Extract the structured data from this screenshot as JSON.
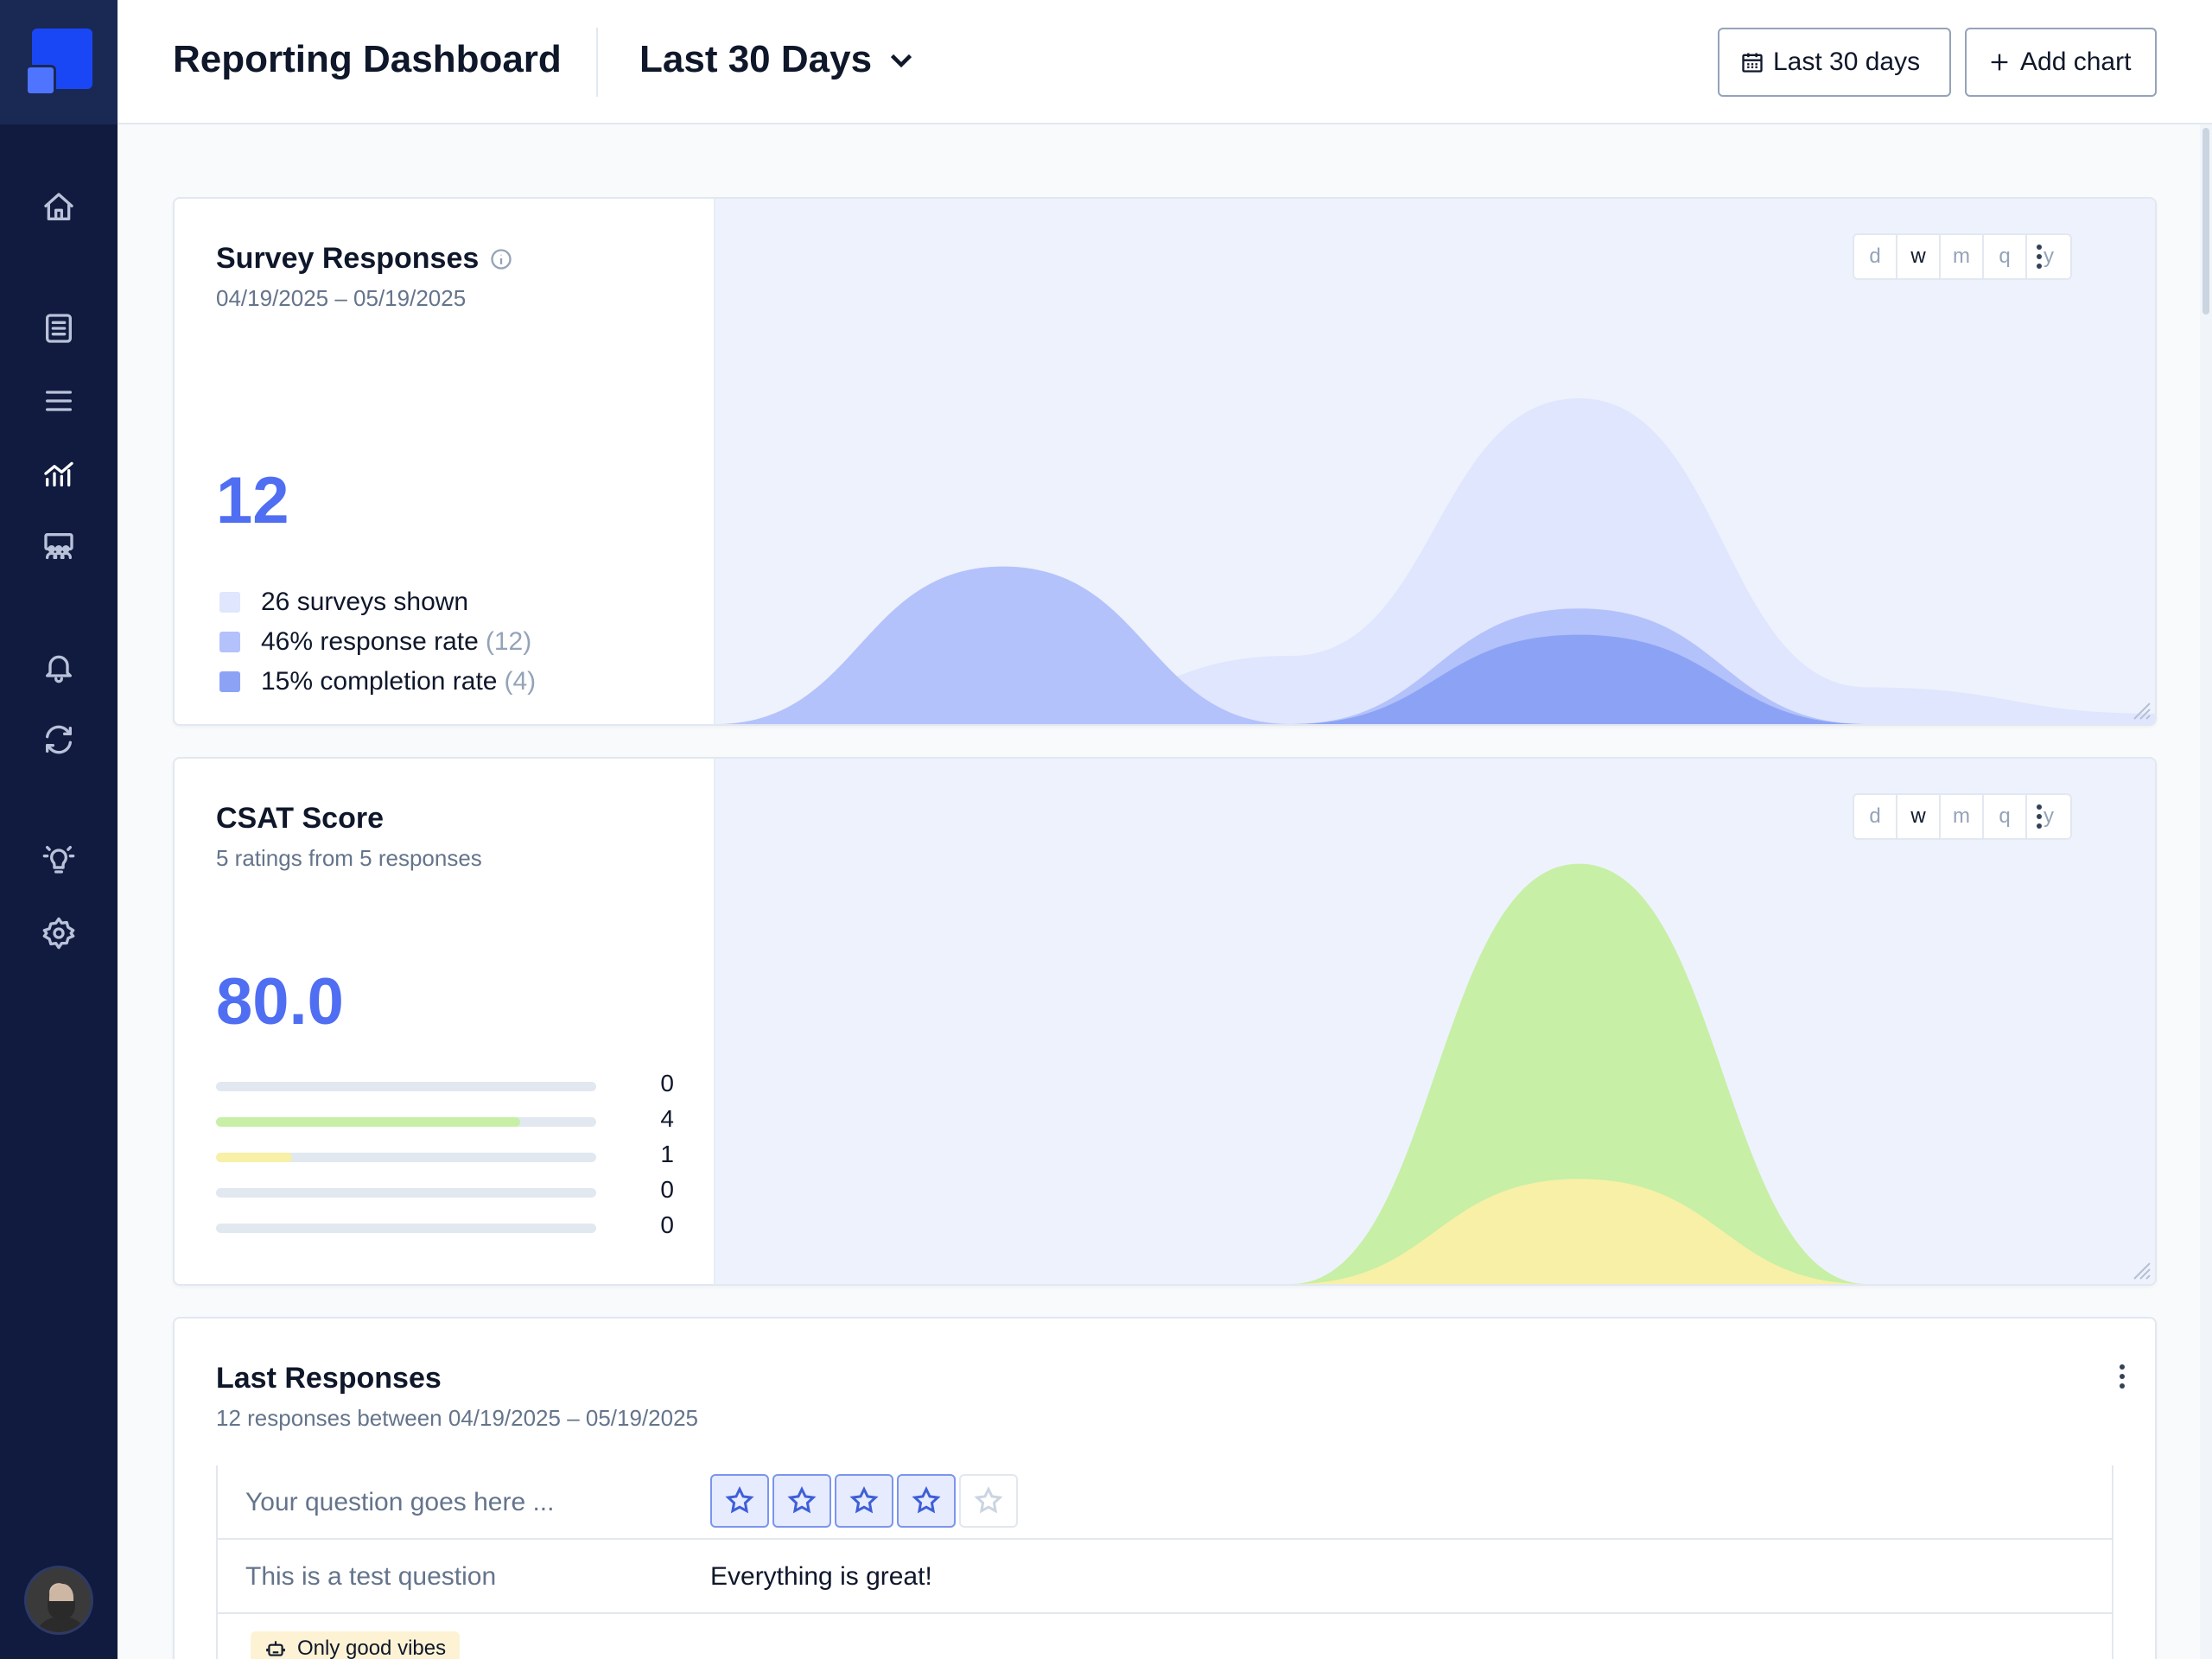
{
  "header": {
    "title": "Reporting Dashboard",
    "period_label": "Last 30 Days",
    "range_button": "Last 30 days",
    "add_chart_button": "Add chart"
  },
  "sidebar": {
    "items": [
      {
        "icon": "home-icon",
        "active": false
      },
      {
        "icon": "surveys-icon",
        "active": false
      },
      {
        "icon": "menu-icon",
        "active": false
      },
      {
        "icon": "analytics-icon",
        "active": true
      },
      {
        "icon": "audience-icon",
        "active": false
      },
      {
        "icon": "bell-icon",
        "active": false
      },
      {
        "icon": "sync-icon",
        "active": false
      },
      {
        "icon": "lightbulb-icon",
        "active": false
      },
      {
        "icon": "settings-icon",
        "active": false
      }
    ]
  },
  "intervals": [
    "d",
    "w",
    "m",
    "q",
    "y"
  ],
  "selected_interval": "w",
  "survey_card": {
    "title": "Survey Responses",
    "date_range": "04/19/2025 – 05/19/2025",
    "value": "12",
    "legend": [
      {
        "text": "26 surveys shown",
        "extra": "",
        "color": "#dfe6fd"
      },
      {
        "text": "46% response rate",
        "extra": "(12)",
        "color": "#b4c2fb"
      },
      {
        "text": "15% completion rate",
        "extra": "(4)",
        "color": "#8ca3f5"
      }
    ],
    "chart_data": {
      "type": "area",
      "series": [
        {
          "name": "26 surveys shown",
          "color": "#dfe6fd",
          "values": [
            0,
            0,
            0.13,
            0.62,
            0.07,
            0.02
          ]
        },
        {
          "name": "46% response rate",
          "color": "#b4c2fb",
          "values": [
            0,
            0.3,
            0,
            0.22,
            0,
            0
          ]
        },
        {
          "name": "15% completion rate",
          "color": "#8ca3f5",
          "values": [
            0,
            0,
            0,
            0.17,
            0,
            0
          ]
        }
      ]
    }
  },
  "csat_card": {
    "title": "CSAT Score",
    "subtitle": "5 ratings from 5 responses",
    "value": "80.0",
    "ratings": [
      {
        "count": "0",
        "fraction": 0,
        "color": "#c7efa6"
      },
      {
        "count": "4",
        "fraction": 0.8,
        "color": "#c7efa6"
      },
      {
        "count": "1",
        "fraction": 0.2,
        "color": "#f7f0a6"
      },
      {
        "count": "0",
        "fraction": 0,
        "color": "#fcd2a8"
      },
      {
        "count": "0",
        "fraction": 0,
        "color": "#f9b4b4"
      }
    ],
    "chart_data": {
      "type": "area",
      "series": [
        {
          "color": "#c7efa6",
          "values": [
            0,
            0,
            0,
            0.8,
            0,
            0
          ]
        },
        {
          "color": "#f7f0a6",
          "values": [
            0,
            0,
            0,
            0.2,
            0,
            0
          ]
        }
      ]
    }
  },
  "responses_card": {
    "title": "Last Responses",
    "subtitle": "12 responses between 04/19/2025 – 05/19/2025",
    "rows": [
      {
        "question": "Your question goes here ...",
        "rating": 4,
        "max": 5
      },
      {
        "question": "This is a test question",
        "answer": "Everything is great!"
      }
    ],
    "tag": "Only good vibes"
  }
}
